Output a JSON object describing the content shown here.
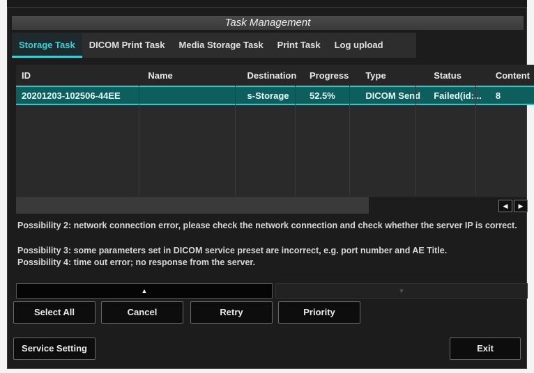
{
  "window": {
    "title": "Task Management"
  },
  "tabs": [
    {
      "label": "Storage Task",
      "active": true
    },
    {
      "label": "DICOM Print Task"
    },
    {
      "label": "Media Storage Task"
    },
    {
      "label": "Print Task"
    },
    {
      "label": "Log upload"
    }
  ],
  "table": {
    "columns": [
      "ID",
      "Name",
      "Destination",
      "Progress",
      "Type",
      "Status",
      "Content"
    ],
    "rows": [
      {
        "id": "20201203-102506-44EE",
        "name": "",
        "destination": "s-Storage",
        "progress": "52.5%",
        "type": "DICOM Send",
        "status": "Failed(id:...",
        "content": "8"
      }
    ]
  },
  "scroll": {
    "left_icon": "arrow-left-icon",
    "right_icon": "arrow-right-icon"
  },
  "messages": {
    "possibility2": "Possibility 2: network connection error, please check the network connection and check whether the server IP is correct.",
    "possibility3": "Possibility 3: some parameters set in DICOM service preset are incorrect, e.g. port number and AE Title.",
    "possibility4": "Possibility 4: time out error; no response from the server."
  },
  "buttons": {
    "select_all": "Select All",
    "cancel": "Cancel",
    "retry": "Retry",
    "priority": "Priority",
    "service_setting": "Service Setting",
    "exit": "Exit"
  },
  "colors": {
    "accent": "#38d0d8",
    "selected_row": "#0f5e5e"
  }
}
